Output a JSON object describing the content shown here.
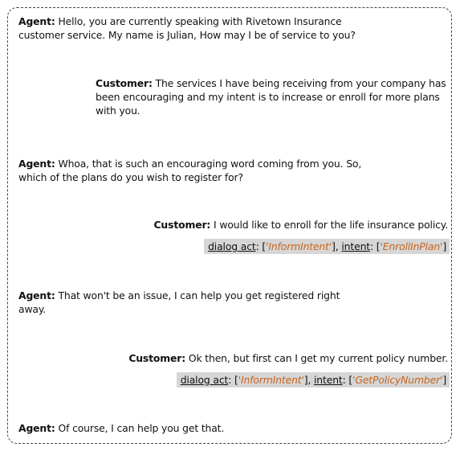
{
  "messages": [
    {
      "speaker": "Agent:",
      "text": "Hello, you are currently speaking with Rivetown Insurance customer service. My name is Julian, How may I be of service to you?"
    },
    {
      "speaker": "Customer:",
      "text": "The services I have being receiving from your company has been encouraging and my intent is to increase or enroll for more plans with you."
    },
    {
      "speaker": "Agent:",
      "text": "Whoa, that is such an encouraging word coming from you. So, which of the plans do you wish to register for?"
    },
    {
      "speaker": "Customer:",
      "text": "I would like to enroll for the life insurance policy."
    },
    {
      "speaker": "Agent:",
      "text": "That won't be an issue, I can help you get registered right away."
    },
    {
      "speaker": "Customer:",
      "text": "Ok then, but first can I get my current policy number."
    },
    {
      "speaker": "Agent:",
      "text": "Of course, I can help you get that."
    }
  ],
  "annotations": [
    {
      "dialog_act_label": "dialog act",
      "dialog_act_value": "'InformIntent'",
      "intent_label": "intent",
      "intent_value": "'EnrollInPlan'"
    },
    {
      "dialog_act_label": "dialog act",
      "dialog_act_value": "'InformIntent'",
      "intent_label": "intent",
      "intent_value": "'GetPolicyNumber'"
    }
  ],
  "colors": {
    "highlight": "#c9641c",
    "annotation_bg": "#d6d6d6"
  }
}
